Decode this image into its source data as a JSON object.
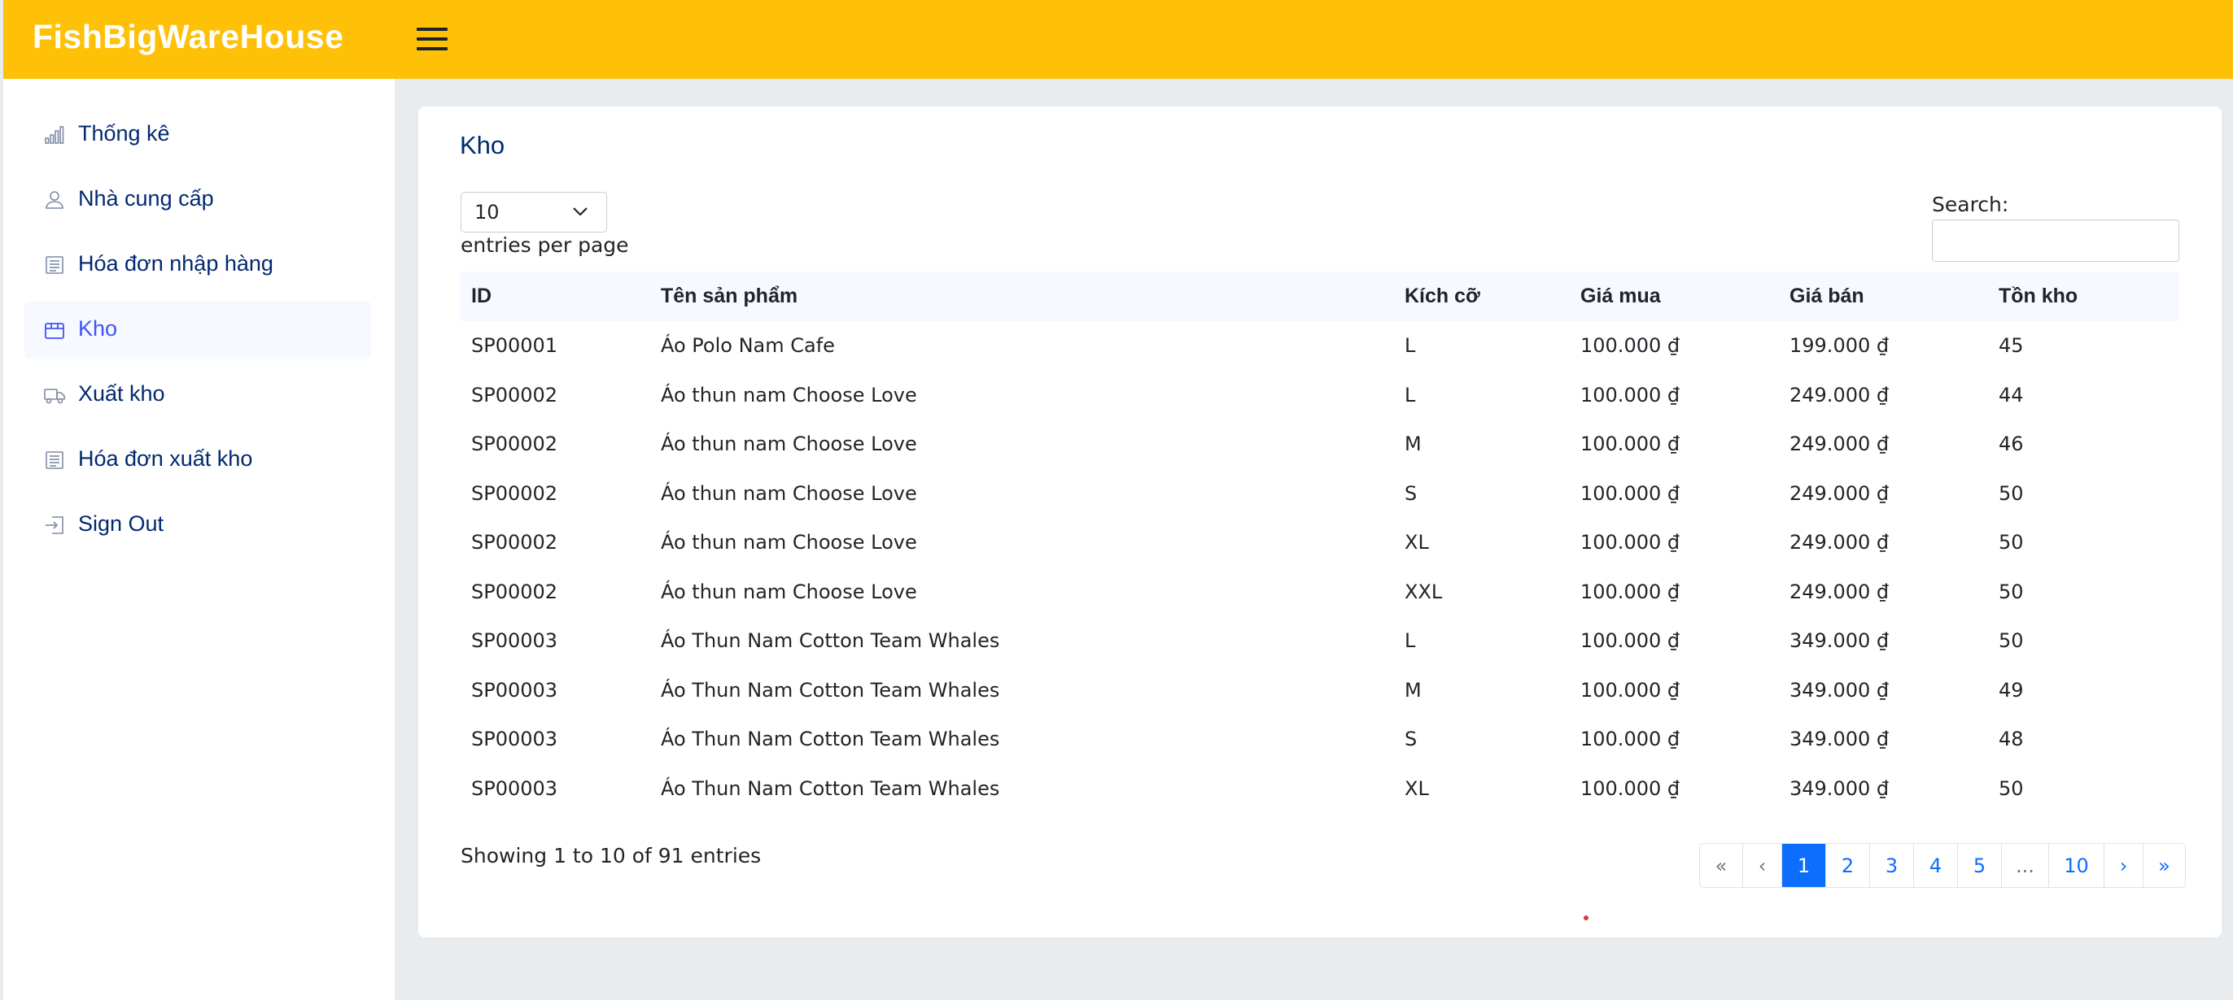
{
  "app": {
    "brand": "FishBigWareHouse"
  },
  "sidebar": {
    "items": [
      {
        "label": "Thống kê",
        "icon": "bar-chart-icon"
      },
      {
        "label": "Nhà cung cấp",
        "icon": "person-icon"
      },
      {
        "label": "Hóa đơn nhập hàng",
        "icon": "receipt-icon"
      },
      {
        "label": "Kho",
        "icon": "box-icon",
        "active": true
      },
      {
        "label": "Xuất kho",
        "icon": "truck-icon"
      },
      {
        "label": "Hóa đơn xuất kho",
        "icon": "receipt-icon"
      },
      {
        "label": "Sign Out",
        "icon": "sign-out-icon"
      }
    ]
  },
  "main": {
    "title": "Kho",
    "per_page": {
      "value": "10",
      "label": "entries per page"
    },
    "search": {
      "label": "Search:",
      "value": ""
    },
    "table": {
      "headers": [
        "ID",
        "Tên sản phẩm",
        "Kích cỡ",
        "Giá mua",
        "Giá bán",
        "Tồn kho"
      ],
      "rows": [
        [
          "SP00001",
          "Áo Polo Nam Cafe",
          "L",
          "100.000 ₫",
          "199.000 ₫",
          "45"
        ],
        [
          "SP00002",
          "Áo thun nam Choose Love",
          "L",
          "100.000 ₫",
          "249.000 ₫",
          "44"
        ],
        [
          "SP00002",
          "Áo thun nam Choose Love",
          "M",
          "100.000 ₫",
          "249.000 ₫",
          "46"
        ],
        [
          "SP00002",
          "Áo thun nam Choose Love",
          "S",
          "100.000 ₫",
          "249.000 ₫",
          "50"
        ],
        [
          "SP00002",
          "Áo thun nam Choose Love",
          "XL",
          "100.000 ₫",
          "249.000 ₫",
          "50"
        ],
        [
          "SP00002",
          "Áo thun nam Choose Love",
          "XXL",
          "100.000 ₫",
          "249.000 ₫",
          "50"
        ],
        [
          "SP00003",
          "Áo Thun Nam Cotton Team Whales",
          "L",
          "100.000 ₫",
          "349.000 ₫",
          "50"
        ],
        [
          "SP00003",
          "Áo Thun Nam Cotton Team Whales",
          "M",
          "100.000 ₫",
          "349.000 ₫",
          "49"
        ],
        [
          "SP00003",
          "Áo Thun Nam Cotton Team Whales",
          "S",
          "100.000 ₫",
          "349.000 ₫",
          "48"
        ],
        [
          "SP00003",
          "Áo Thun Nam Cotton Team Whales",
          "XL",
          "100.000 ₫",
          "349.000 ₫",
          "50"
        ]
      ]
    },
    "info": "Showing 1 to 10 of 91 entries",
    "pagination": {
      "items": [
        "«",
        "‹",
        "1",
        "2",
        "3",
        "4",
        "5",
        "...",
        "10",
        "›",
        "»"
      ],
      "active": "1"
    }
  },
  "colors": {
    "header": "#ffc107",
    "accent": "#4154f1",
    "nav_text": "#012970",
    "pagination_active": "#0d6efd"
  }
}
